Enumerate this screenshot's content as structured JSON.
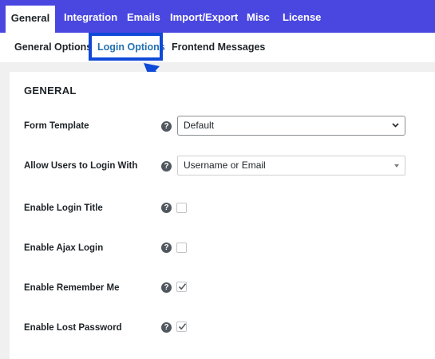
{
  "top_tabs": [
    {
      "label": "General",
      "active": true
    },
    {
      "label": "Integration",
      "active": false
    },
    {
      "label": "Emails",
      "active": false
    },
    {
      "label": "Import/Export",
      "active": false
    },
    {
      "label": "Misc",
      "active": false
    },
    {
      "label": "License",
      "active": false
    }
  ],
  "sub_tabs": [
    {
      "label": "General Options",
      "active": false
    },
    {
      "label": "Login Options",
      "active": true
    },
    {
      "label": "Frontend Messages",
      "active": false
    }
  ],
  "section": {
    "title": "GENERAL"
  },
  "fields": {
    "form_template": {
      "label": "Form Template",
      "value": "Default"
    },
    "allow_login_with": {
      "label": "Allow Users to Login With",
      "value": "Username or Email"
    },
    "enable_login_title": {
      "label": "Enable Login Title",
      "checked": false
    },
    "enable_ajax_login": {
      "label": "Enable Ajax Login",
      "checked": false
    },
    "enable_remember_me": {
      "label": "Enable Remember Me",
      "checked": true
    },
    "enable_lost_password": {
      "label": "Enable Lost Password",
      "checked": true
    }
  },
  "help_glyph": "?",
  "icons": {
    "help": "question-circle-icon",
    "dropdown": "chevron-down-icon",
    "check": "checkmark-icon",
    "annotation": "pointer-arrow-icon"
  },
  "colors": {
    "tab_bar": "#4a47e0",
    "active_subtab": "#2271b1",
    "highlight": "#0f49d8",
    "page_bg": "#f0f0f1"
  }
}
